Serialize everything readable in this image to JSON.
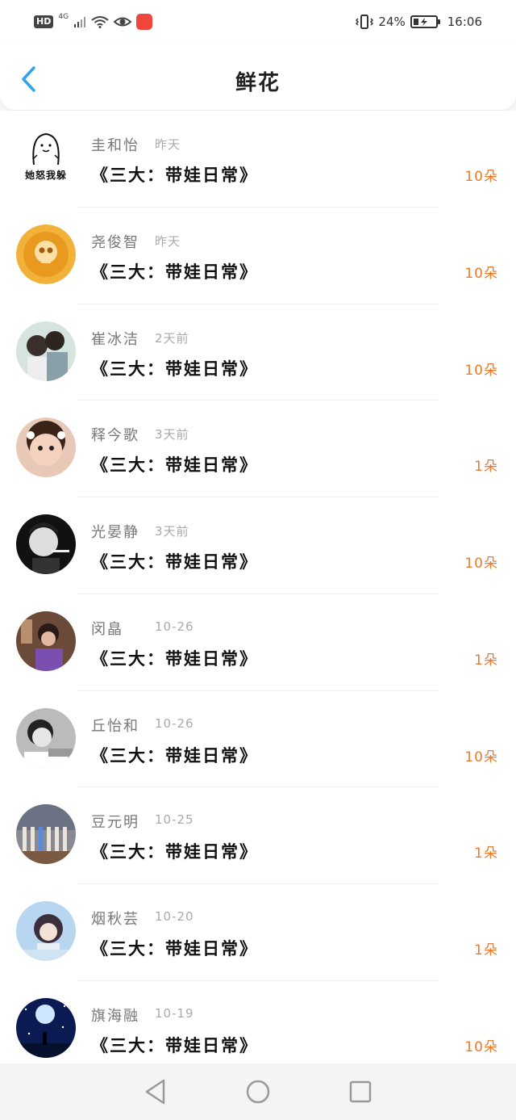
{
  "status_bar": {
    "hd_label": "HD",
    "network_label": "4G",
    "battery_percent": "24%",
    "battery_level": 0.24,
    "time": "16:06"
  },
  "header": {
    "title": "鲜花",
    "back_icon": "chevron-left-icon"
  },
  "colors": {
    "accent_blue": "#2ea5e8",
    "flower_orange": "#f07a2c"
  },
  "items": [
    {
      "name": "圭和怡",
      "time": "昨天",
      "book": "《三大：带娃日常》",
      "count": "10朵",
      "avatar_caption": "她怒我躲",
      "avatar_style": "meme"
    },
    {
      "name": "尧俊智",
      "time": "昨天",
      "book": "《三大：带娃日常》",
      "count": "10朵",
      "avatar_style": "skull"
    },
    {
      "name": "崔冰洁",
      "time": "2天前",
      "book": "《三大：带娃日常》",
      "count": "10朵",
      "avatar_style": "couple"
    },
    {
      "name": "释今歌",
      "time": "3天前",
      "book": "《三大：带娃日常》",
      "count": "1朵",
      "avatar_style": "child"
    },
    {
      "name": "光晏静",
      "time": "3天前",
      "book": "《三大：带娃日常》",
      "count": "10朵",
      "avatar_style": "bw-man"
    },
    {
      "name": "闵皛",
      "time": "10-26",
      "book": "《三大：带娃日常》",
      "count": "1朵",
      "avatar_style": "purple"
    },
    {
      "name": "丘怡和",
      "time": "10-26",
      "book": "《三大：带娃日常》",
      "count": "10朵",
      "avatar_style": "gray-man"
    },
    {
      "name": "豆元明",
      "time": "10-25",
      "book": "《三大：带娃日常》",
      "count": "1朵",
      "avatar_style": "group"
    },
    {
      "name": "烟秋芸",
      "time": "10-20",
      "book": "《三大：带娃日常》",
      "count": "1朵",
      "avatar_style": "anime"
    },
    {
      "name": "旗海融",
      "time": "10-19",
      "book": "《三大：带娃日常》",
      "count": "10朵",
      "avatar_style": "night"
    }
  ],
  "bottom_nav": {
    "back": "triangle-back-icon",
    "home": "circle-home-icon",
    "recents": "square-recents-icon"
  }
}
